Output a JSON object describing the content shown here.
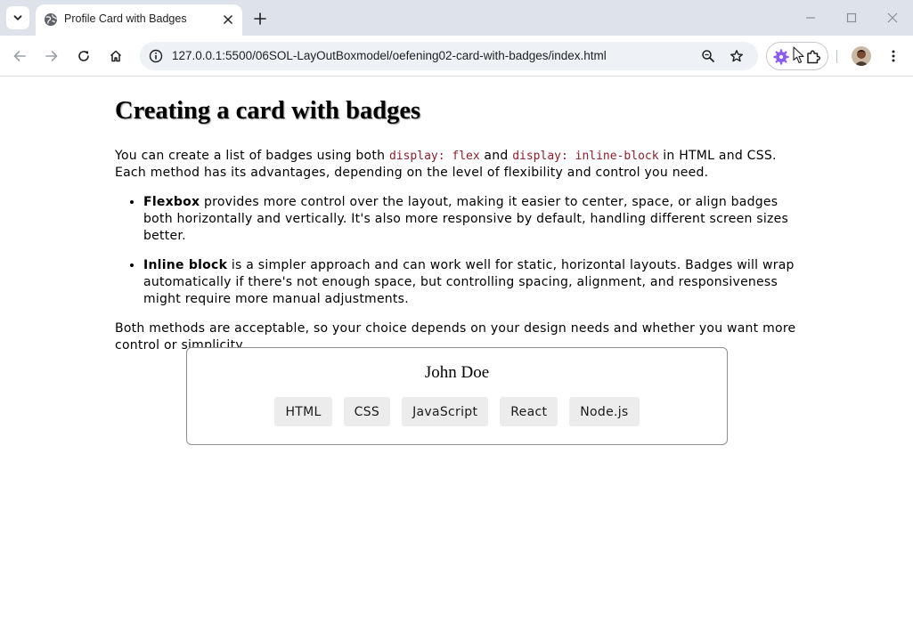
{
  "browser": {
    "tab_title": "Profile Card with Badges",
    "url": "127.0.0.1:5500/06SOL-LayOutBoxmodel/oefening02-card-with-badges/index.html",
    "colors": {
      "tabstrip": "#dee3eb",
      "omnibox": "#eef1f6",
      "extension": "#8a5cf6"
    }
  },
  "content": {
    "heading": "Creating a card with badges",
    "intro": {
      "part1": "You can create a list of badges using both ",
      "code1": "display: flex",
      "part2": " and ",
      "code2": "display: inline-block",
      "part3": " in HTML and CSS. Each method has its advantages, depending on the level of flexibility and control you need."
    },
    "points": [
      {
        "term": "Flexbox",
        "text": " provides more control over the layout, making it easier to center, space, or align badges both horizontally and vertically. It's also more responsive by default, handling different screen sizes better."
      },
      {
        "term": "Inline block",
        "text": " is a simpler approach and can work well for static, horizontal layouts. Badges will wrap automatically if there's not enough space, but controlling spacing, alignment, and responsiveness might require more manual adjustments."
      }
    ],
    "outro": "Both methods are acceptable, so your choice depends on your design needs and whether you want more control or simplicity.",
    "code_color": "#8b1f2c"
  },
  "card": {
    "name": "John Doe",
    "badges": [
      "HTML",
      "CSS",
      "JavaScript",
      "React",
      "Node.js"
    ],
    "badge_bg": "#ececec"
  }
}
